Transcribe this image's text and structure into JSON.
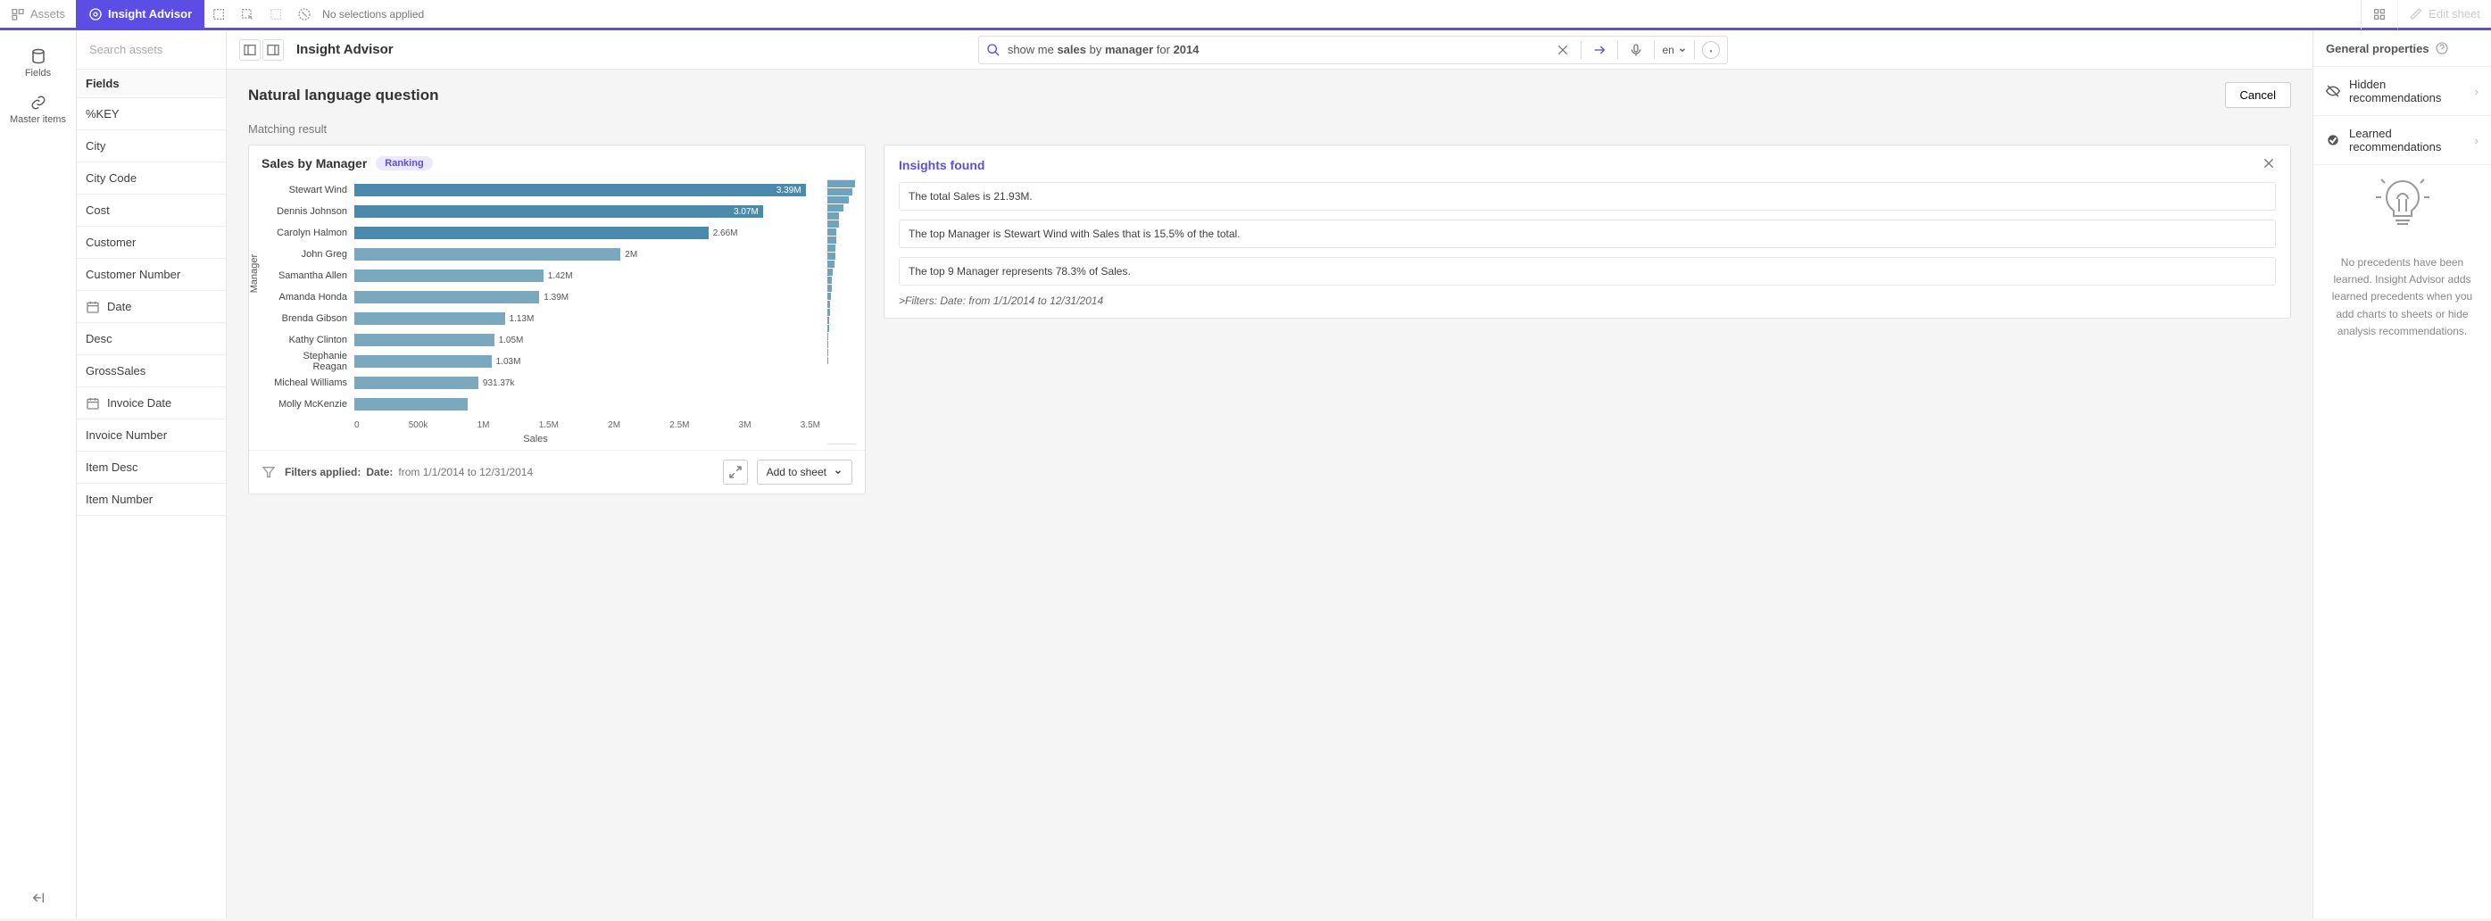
{
  "topbar": {
    "assets": "Assets",
    "insight": "Insight Advisor",
    "no_selections": "No selections applied",
    "edit_sheet": "Edit sheet"
  },
  "advisor_bar": {
    "title": "Insight Advisor",
    "query_prefix": "show me ",
    "query_bold1": "sales",
    "query_mid": " by ",
    "query_bold2": "manager",
    "query_mid2": " for ",
    "query_bold3": "2014",
    "lang": "en"
  },
  "sidebar": {
    "search_placeholder": "Search assets",
    "section": "Fields",
    "items": [
      {
        "label": "%KEY"
      },
      {
        "label": "City"
      },
      {
        "label": "City Code"
      },
      {
        "label": "Cost"
      },
      {
        "label": "Customer"
      },
      {
        "label": "Customer Number"
      },
      {
        "label": "Date",
        "icon": "date"
      },
      {
        "label": "Desc"
      },
      {
        "label": "GrossSales"
      },
      {
        "label": "Invoice Date",
        "icon": "date"
      },
      {
        "label": "Invoice Number"
      },
      {
        "label": "Item Desc"
      },
      {
        "label": "Item Number"
      }
    ]
  },
  "rail": {
    "fields": "Fields",
    "master": "Master items"
  },
  "center": {
    "nlq_heading": "Natural language question",
    "cancel": "Cancel",
    "matching": "Matching result"
  },
  "card": {
    "title": "Sales by Manager",
    "badge": "Ranking",
    "ylabel": "Manager",
    "xlabel": "Sales",
    "filters_label": "Filters applied:",
    "filters_dim": "Date:",
    "filters_val": "from 1/1/2014 to 12/31/2014",
    "add_to_sheet": "Add to sheet"
  },
  "chart_data": {
    "type": "bar",
    "orientation": "horizontal",
    "title": "Sales by Manager",
    "xlabel": "Sales",
    "ylabel": "Manager",
    "xlim": [
      0,
      3500000
    ],
    "xticks": [
      "0",
      "500k",
      "1M",
      "1.5M",
      "2M",
      "2.5M",
      "3M",
      "3.5M"
    ],
    "categories": [
      "Stewart Wind",
      "Dennis Johnson",
      "Carolyn Halmon",
      "John Greg",
      "Samantha Allen",
      "Amanda Honda",
      "Brenda Gibson",
      "Kathy Clinton",
      "Stephanie Reagan",
      "Micheal Williams",
      "Molly McKenzie"
    ],
    "values": [
      3390000,
      3070000,
      2660000,
      2000000,
      1420000,
      1390000,
      1130000,
      1050000,
      1030000,
      931370,
      850000
    ],
    "value_labels": [
      "3.39M",
      "3.07M",
      "2.66M",
      "2M",
      "1.42M",
      "1.39M",
      "1.13M",
      "1.05M",
      "1.03M",
      "931.37k",
      ""
    ],
    "bar_color": "#4a8bad",
    "bar_color_light": "#7aa9bf"
  },
  "insights": {
    "heading": "Insights found",
    "items": [
      "The total Sales is 21.93M.",
      "The top Manager is Stewart Wind with Sales that is 15.5% of the total.",
      "The top 9 Manager represents 78.3% of Sales."
    ],
    "filters_note": ">Filters: Date: from 1/1/2014 to 12/31/2014"
  },
  "props": {
    "heading": "General properties",
    "rows": [
      {
        "label": "Hidden recommendations",
        "icon": "eye-off"
      },
      {
        "label": "Learned recommendations",
        "icon": "check"
      }
    ],
    "empty": "No precedents have been learned. Insight Advisor adds learned precedents when you add charts to sheets or hide analysis recommendations."
  }
}
